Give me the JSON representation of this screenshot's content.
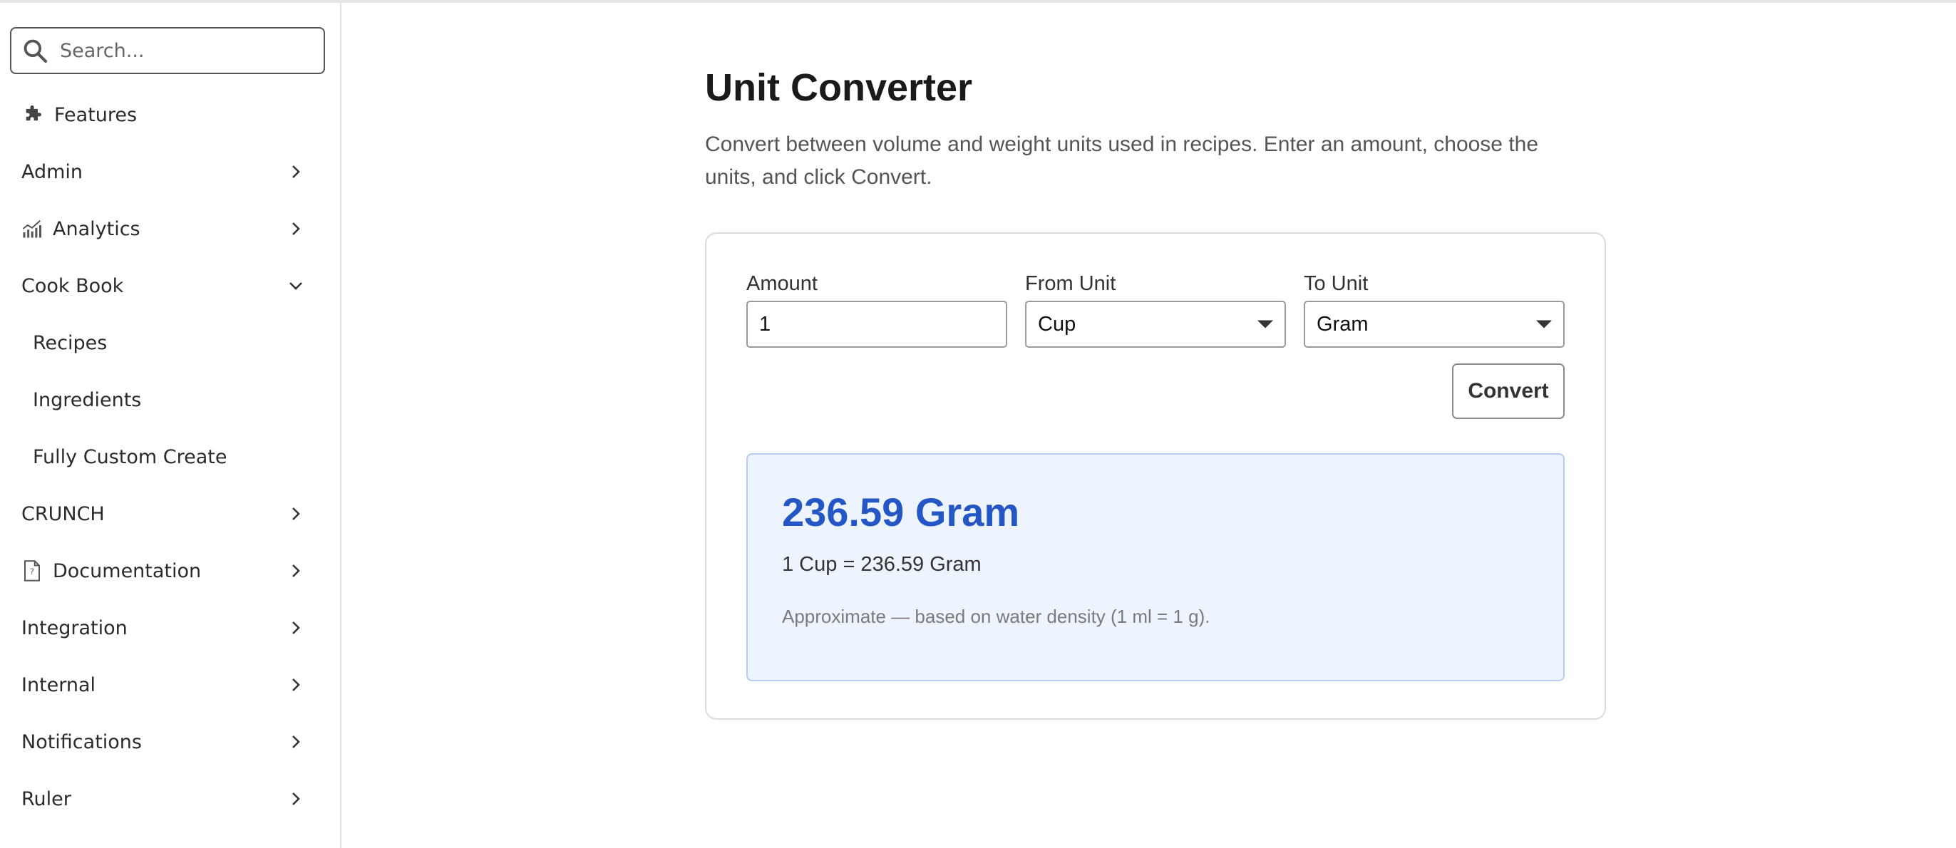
{
  "sidebar": {
    "search_placeholder": "Search...",
    "items": [
      {
        "label": "Features",
        "icon": "puzzle-icon"
      },
      {
        "label": "Admin"
      },
      {
        "label": "Analytics",
        "icon": "chart-icon"
      },
      {
        "label": "Cook Book",
        "expanded": true
      },
      {
        "label": "Recipes"
      },
      {
        "label": "Ingredients"
      },
      {
        "label": "Fully Custom Create"
      },
      {
        "label": "CRUNCH"
      },
      {
        "label": "Documentation",
        "icon": "document-icon"
      },
      {
        "label": "Integration"
      },
      {
        "label": "Internal"
      },
      {
        "label": "Notifications"
      },
      {
        "label": "Ruler"
      }
    ]
  },
  "main": {
    "title": "Unit Converter",
    "description": "Convert between volume and weight units used in recipes. Enter an amount, choose the units, and click Convert.",
    "form": {
      "amount_label": "Amount",
      "amount_value": "1",
      "from_label": "From Unit",
      "from_value": "Cup",
      "to_label": "To Unit",
      "to_value": "Gram",
      "convert_label": "Convert"
    },
    "result": {
      "headline": "236.59 Gram",
      "equation": "1 Cup = 236.59 Gram",
      "note": "Approximate — based on water density (1 ml = 1 g)."
    }
  },
  "colors": {
    "accent": "#2457c5",
    "result_bg": "#eef4fd",
    "result_border": "#b6cdee"
  }
}
